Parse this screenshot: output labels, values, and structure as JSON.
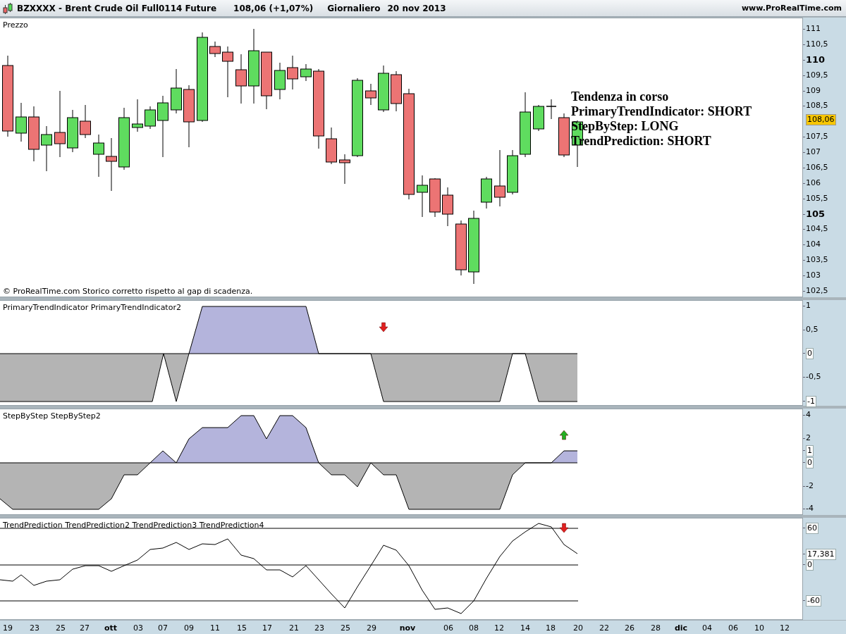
{
  "header": {
    "symbol": "BZXXXX - Brent Crude Oil Full0114 Future",
    "quote": "108,06 (+1,07%)",
    "period": "Giornaliero",
    "date": "20 nov 2013",
    "website": "www.ProRealTime.com"
  },
  "price_pane": {
    "title": "Prezzo",
    "footer": "© ProRealTime.com  Storico corretto rispetto al gap di scadenza.",
    "overlay": [
      "Tendenza in corso",
      "PrimaryTrendIndicator: SHORT",
      "StepByStep: LONG",
      "TrendPrediction: SHORT"
    ],
    "last_price": "108,06",
    "axis_labels": [
      {
        "label": "111",
        "bold": false
      },
      {
        "label": "110,5",
        "bold": false
      },
      {
        "label": "110",
        "bold": true
      },
      {
        "label": "109,5",
        "bold": false
      },
      {
        "label": "109",
        "bold": false
      },
      {
        "label": "108,5",
        "bold": false
      },
      {
        "label": "107,5",
        "bold": false
      },
      {
        "label": "107",
        "bold": false
      },
      {
        "label": "106,5",
        "bold": false
      },
      {
        "label": "106",
        "bold": false
      },
      {
        "label": "105,5",
        "bold": false
      },
      {
        "label": "105",
        "bold": true
      },
      {
        "label": "104,5",
        "bold": false
      },
      {
        "label": "104",
        "bold": false
      },
      {
        "label": "103,5",
        "bold": false
      },
      {
        "label": "103",
        "bold": false
      },
      {
        "label": "102,5",
        "bold": false
      }
    ]
  },
  "indicator_panes": [
    {
      "kind": "area",
      "title": "PrimaryTrendIndicator PrimaryTrendIndicator2",
      "axis_labels": [
        {
          "label": "1",
          "boxed": false
        },
        {
          "label": "0,5",
          "boxed": false
        },
        {
          "label": "0",
          "boxed": true
        },
        {
          "label": "-0,5",
          "boxed": false
        },
        {
          "label": "-1",
          "boxed": true
        }
      ]
    },
    {
      "kind": "area",
      "title": "StepByStep StepByStep2",
      "axis_labels": [
        {
          "label": "4",
          "boxed": false
        },
        {
          "label": "2",
          "boxed": false
        },
        {
          "label": "1",
          "boxed": true
        },
        {
          "label": "0",
          "boxed": true
        },
        {
          "label": "-2",
          "boxed": false
        },
        {
          "label": "-4",
          "boxed": false
        }
      ]
    },
    {
      "kind": "line",
      "title": "TrendPrediction TrendPrediction2 TrendPrediction3 TrendPrediction4",
      "axis_labels": [
        {
          "label": "60",
          "boxed": true
        },
        {
          "label": "17,381",
          "boxed": true
        },
        {
          "label": "0",
          "boxed": true
        },
        {
          "label": "-60",
          "boxed": true
        }
      ]
    }
  ],
  "x_axis": [
    {
      "label": "19",
      "bold": false
    },
    {
      "label": "23",
      "bold": false
    },
    {
      "label": "25",
      "bold": false
    },
    {
      "label": "27",
      "bold": false
    },
    {
      "label": "ott",
      "bold": true
    },
    {
      "label": "03",
      "bold": false
    },
    {
      "label": "07",
      "bold": false
    },
    {
      "label": "09",
      "bold": false
    },
    {
      "label": "11",
      "bold": false
    },
    {
      "label": "15",
      "bold": false
    },
    {
      "label": "17",
      "bold": false
    },
    {
      "label": "21",
      "bold": false
    },
    {
      "label": "23",
      "bold": false
    },
    {
      "label": "25",
      "bold": false
    },
    {
      "label": "29",
      "bold": false
    },
    {
      "label": "nov",
      "bold": true
    },
    {
      "label": "06",
      "bold": false
    },
    {
      "label": "08",
      "bold": false
    },
    {
      "label": "12",
      "bold": false
    },
    {
      "label": "14",
      "bold": false
    },
    {
      "label": "18",
      "bold": false
    },
    {
      "label": "20",
      "bold": false
    },
    {
      "label": "22",
      "bold": false
    },
    {
      "label": "26",
      "bold": false
    },
    {
      "label": "28",
      "bold": false
    },
    {
      "label": "dic",
      "bold": true
    },
    {
      "label": "04",
      "bold": false
    },
    {
      "label": "06",
      "bold": false
    },
    {
      "label": "10",
      "bold": false
    },
    {
      "label": "12",
      "bold": false
    }
  ]
}
